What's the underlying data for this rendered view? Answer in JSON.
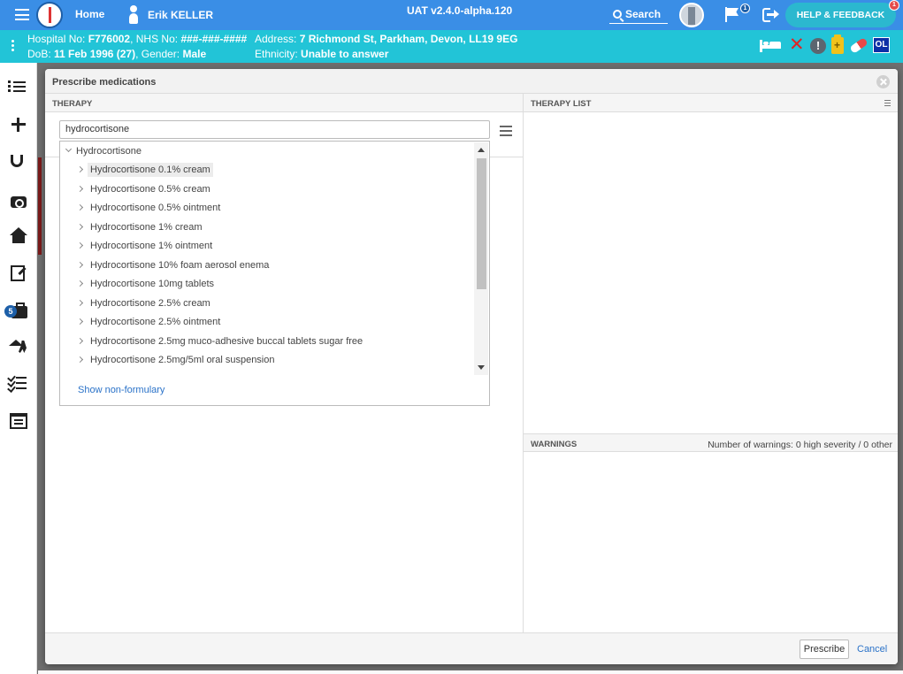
{
  "topbar": {
    "home_label": "Home",
    "user_name": "Erik KELLER",
    "version": "UAT v2.4.0-alpha.120",
    "search_label": "Search",
    "flag_badge": "1",
    "help_label": "HELP & FEEDBACK",
    "help_badge": "1",
    "bar_color": "#3a8ee6"
  },
  "patient": {
    "hospital_label": "Hospital No:",
    "hospital_no": "F776002",
    "nhs_label": "NHS No:",
    "nhs_no": "###-###-####",
    "dob_label": "DoB:",
    "dob": "11 Feb 1996 (27)",
    "gender_label": "Gender:",
    "gender": "Male",
    "address_label": "Address:",
    "address": "7 Richmond St, Parkham, Devon, LL19 9EG",
    "ethnicity_label": "Ethnicity:",
    "ethnicity": "Unable to answer",
    "alert_mark": "!",
    "ol_label": "OL",
    "banner_color": "#22c4d7"
  },
  "sidebar": {
    "items": [
      "list-icon",
      "plus-icon",
      "stethoscope-icon",
      "camera-icon",
      "home-icon",
      "document-edit-icon",
      "briefcase-icon",
      "running-icon",
      "checklist-icon",
      "register-icon"
    ],
    "briefcase_badge": "5"
  },
  "modal": {
    "title": "Prescribe medications",
    "therapy_header": "THERAPY",
    "therapy_list_header": "THERAPY LIST",
    "warnings_header": "WARNINGS",
    "warnings_summary": "Number of warnings: 0 high severity / 0 other",
    "search_value": "hydrocortisone",
    "tree_root": "Hydrocortisone",
    "results": [
      "Hydrocortisone 0.1% cream",
      "Hydrocortisone 0.5% cream",
      "Hydrocortisone 0.5% ointment",
      "Hydrocortisone 1% cream",
      "Hydrocortisone 1% ointment",
      "Hydrocortisone 10% foam aerosol enema",
      "Hydrocortisone 10mg tablets",
      "Hydrocortisone 2.5% cream",
      "Hydrocortisone 2.5% ointment",
      "Hydrocortisone 2.5mg muco-adhesive buccal tablets sugar free",
      "Hydrocortisone 2.5mg/5ml oral suspension"
    ],
    "show_non_formulary": "Show non-formulary",
    "prescribe_label": "Prescribe",
    "cancel_label": "Cancel"
  }
}
